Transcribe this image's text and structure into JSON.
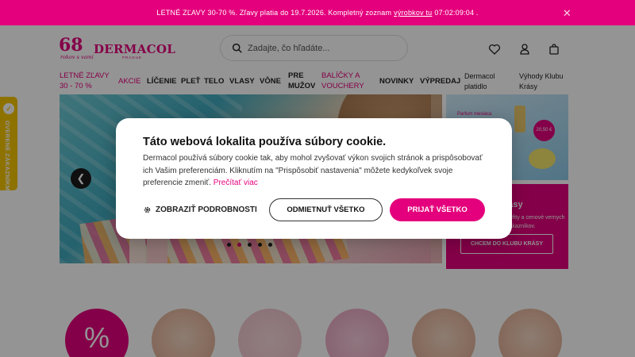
{
  "promo": {
    "text_before": "LETNÉ ZĽAVY 30-70 %. Zľavy platia do 19.7.2026. Kompletný zoznam",
    "link": "výrobkov tu",
    "countdown": "07:02:09:04 ."
  },
  "logo": {
    "mark": "68",
    "tagline": "rokov s vami",
    "brand": "DERMACOL",
    "sub": "PRAGUE"
  },
  "search": {
    "placeholder": "Zadajte, čo hľadáte..."
  },
  "nav": {
    "items": [
      "LETNÉ ZĽAVY",
      "30 - 70 %",
      "AKCIE",
      "LÍČENIE",
      "PLEŤ",
      "TELO",
      "VLASY",
      "VÔNE",
      "PRE",
      "MUŽOV",
      "BALÍČKY A",
      "VOUCHERY",
      "NOVINKY",
      "VÝPREDAJ",
      "Dermacol",
      "platidlo",
      "Výhody Klubu",
      "Krásy"
    ]
  },
  "side": {
    "top_text": "Parfum mesiaca",
    "top_price": "20,50 €",
    "bot_title": "rásy",
    "bot_desc": "nefity a cenové vernych zákazníkov.",
    "bot_button": "CHCEM DO KLUBU KRÁSY"
  },
  "verified_badge": "OVERENÉ ZÁKAZNÍKMI",
  "categories": [
    "%"
  ],
  "cookie": {
    "title": "Táto webová lokalita používa súbory cookie.",
    "body": "Dermacol používá súbory cookie tak, aby mohol zvyšovať výkon svojich stránok a prispôsobovať ich Vašim preferenciám. Kliknutím na \"Prispôsobiť nastavenia\" môžete kedykoľvek svoje preferencie zmeniť.",
    "read_more": "Prečítať viac",
    "details": "ZOBRAZIŤ PODROBNOSTI",
    "reject": "ODMIETNUŤ VŠETKO",
    "accept": "PRIJAŤ VŠETKO"
  },
  "colors": {
    "brand": "#e4007c",
    "badge": "#f5c400"
  }
}
